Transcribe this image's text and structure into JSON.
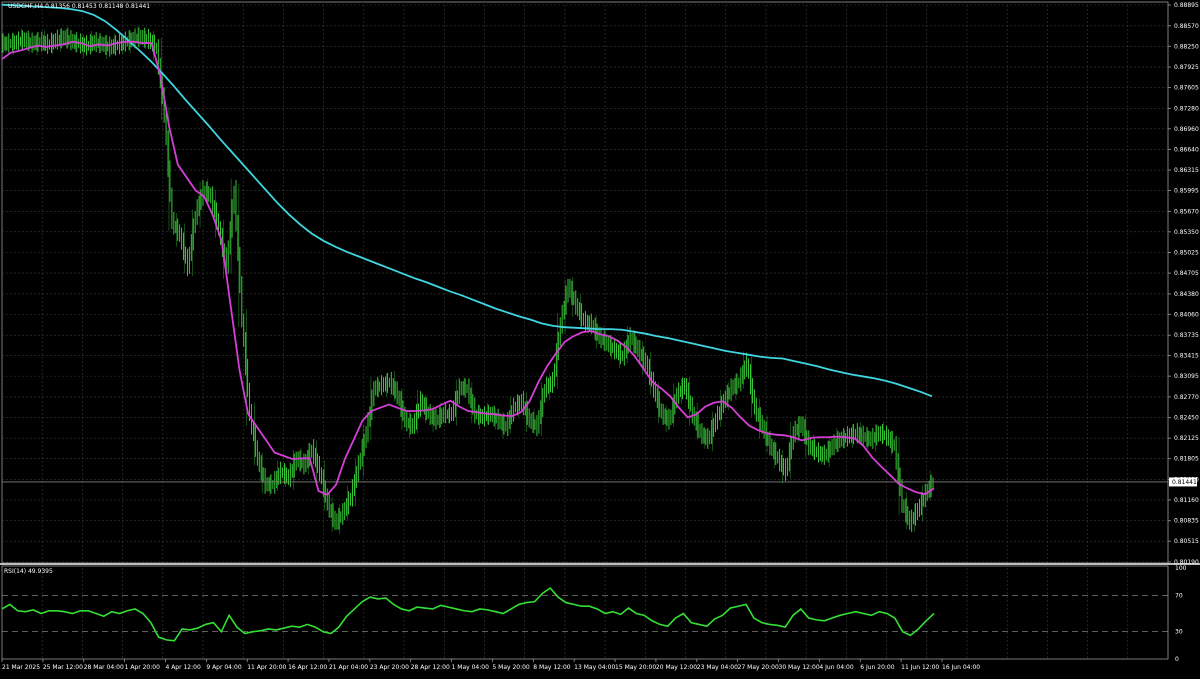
{
  "header": {
    "symbol_line": "USDCHF,H4  0.81356 0.81453 0.81148 0.81441",
    "rsi_label": "RSI(14) 49.9395"
  },
  "colors": {
    "background": "#000000",
    "grid": "#3a3a3a",
    "candle": "#3fdc3f",
    "ma_fast": "#d63fd6",
    "ma_slow": "#3fd6e0",
    "rsi": "#35e035",
    "axis_text": "#ffffff"
  },
  "chart_data": [
    {
      "type": "line",
      "name": "price",
      "x_labels": [
        "21 Mar 2025",
        "25 Mar 12:00",
        "28 Mar 04:00",
        "1 Apr 20:00",
        "4 Apr 12:00",
        "9 Apr 04:00",
        "11 Apr 20:00",
        "16 Apr 12:00",
        "21 Apr 04:00",
        "23 Apr 20:00",
        "28 Apr 12:00",
        "1 May 04:00",
        "5 May 20:00",
        "8 May 12:00",
        "13 May 04:00",
        "15 May 20:00",
        "20 May 12:00",
        "23 May 04:00",
        "27 May 20:00",
        "30 May 12:00",
        "4 Jun 04:00",
        "6 Jun 20:00",
        "11 Jun 12:00",
        "16 Jun 04:00"
      ],
      "y_ticks": [
        0.88895,
        0.8857,
        0.8825,
        0.87925,
        0.87605,
        0.8728,
        0.8696,
        0.8664,
        0.86315,
        0.85995,
        0.8567,
        0.8535,
        0.85025,
        0.84705,
        0.8438,
        0.8406,
        0.83735,
        0.83415,
        0.83095,
        0.8277,
        0.8245,
        0.82125,
        0.81805,
        0.8148,
        0.8116,
        0.80835,
        0.80515,
        0.8019
      ],
      "ylim": [
        0.8019,
        0.88895
      ],
      "current_price": 0.81441,
      "price_close": [
        0.8829,
        0.8831,
        0.8835,
        0.8829,
        0.8832,
        0.8827,
        0.8834,
        0.8838,
        0.8833,
        0.8829,
        0.8825,
        0.8831,
        0.8828,
        0.8823,
        0.8827,
        0.8832,
        0.8836,
        0.8839,
        0.8835,
        0.882,
        0.872,
        0.855,
        0.853,
        0.848,
        0.856,
        0.86,
        0.859,
        0.854,
        0.848,
        0.86,
        0.84,
        0.825,
        0.818,
        0.814,
        0.814,
        0.816,
        0.815,
        0.818,
        0.817,
        0.8195,
        0.816,
        0.811,
        0.808,
        0.8095,
        0.812,
        0.817,
        0.822,
        0.829,
        0.8295,
        0.83,
        0.828,
        0.824,
        0.823,
        0.827,
        0.825,
        0.824,
        0.825,
        0.825,
        0.829,
        0.829,
        0.825,
        0.8245,
        0.825,
        0.824,
        0.823,
        0.826,
        0.827,
        0.824,
        0.823,
        0.829,
        0.83,
        0.839,
        0.845,
        0.842,
        0.8395,
        0.839,
        0.837,
        0.836,
        0.835,
        0.834,
        0.837,
        0.835,
        0.833,
        0.829,
        0.825,
        0.824,
        0.828,
        0.8295,
        0.825,
        0.822,
        0.821,
        0.824,
        0.827,
        0.829,
        0.83,
        0.833,
        0.826,
        0.823,
        0.82,
        0.818,
        0.816,
        0.822,
        0.8235,
        0.82,
        0.819,
        0.8185,
        0.82,
        0.821,
        0.8215,
        0.822,
        0.8215,
        0.821,
        0.822,
        0.8215,
        0.82,
        0.811,
        0.808,
        0.81,
        0.8125,
        0.8144
      ],
      "ma_slow": [
        0.889,
        0.8889,
        0.8888,
        0.8887,
        0.8886,
        0.8885,
        0.8883,
        0.888,
        0.8874,
        0.8864,
        0.885,
        0.8834,
        0.8818,
        0.8801,
        0.8782,
        0.8762,
        0.8741,
        0.8721,
        0.8701,
        0.868,
        0.866,
        0.864,
        0.862,
        0.86,
        0.858,
        0.8562,
        0.8546,
        0.8532,
        0.8521,
        0.8512,
        0.8504,
        0.8497,
        0.849,
        0.8483,
        0.8476,
        0.8469,
        0.8462,
        0.8456,
        0.8449,
        0.8442,
        0.8436,
        0.8429,
        0.8422,
        0.8415,
        0.8409,
        0.8403,
        0.8398,
        0.8392,
        0.8388,
        0.8386,
        0.8385,
        0.8384,
        0.8383,
        0.8383,
        0.8382,
        0.8379,
        0.8376,
        0.8372,
        0.8369,
        0.8365,
        0.8361,
        0.8357,
        0.8353,
        0.8349,
        0.8346,
        0.8343,
        0.834,
        0.8338,
        0.8337,
        0.8333,
        0.8329,
        0.8325,
        0.832,
        0.8316,
        0.8312,
        0.8309,
        0.8306,
        0.8302,
        0.8297,
        0.8291,
        0.8285,
        0.8278
      ],
      "ma_fast": [
        0.8805,
        0.8815,
        0.8818,
        0.8822,
        0.8826,
        0.8824,
        0.8826,
        0.8828,
        0.8832,
        0.883,
        0.8825,
        0.8828,
        0.8826,
        0.883,
        0.8832,
        0.8832,
        0.883,
        0.883,
        0.878,
        0.87,
        0.864,
        0.862,
        0.86,
        0.859,
        0.856,
        0.852,
        0.842,
        0.832,
        0.825,
        0.823,
        0.821,
        0.819,
        0.8185,
        0.818,
        0.8181,
        0.8181,
        0.813,
        0.8124,
        0.814,
        0.818,
        0.821,
        0.824,
        0.8255,
        0.826,
        0.8265,
        0.826,
        0.8255,
        0.8255,
        0.8256,
        0.8258,
        0.8265,
        0.8271,
        0.8262,
        0.8255,
        0.8253,
        0.8251,
        0.825,
        0.8248,
        0.8247,
        0.8253,
        0.827,
        0.83,
        0.8325,
        0.8345,
        0.8363,
        0.8372,
        0.8378,
        0.838,
        0.8375,
        0.8372,
        0.8365,
        0.8355,
        0.834,
        0.832,
        0.83,
        0.829,
        0.8278,
        0.826,
        0.8245,
        0.825,
        0.8262,
        0.8268,
        0.827,
        0.826,
        0.8245,
        0.8232,
        0.8225,
        0.822,
        0.8218,
        0.8217,
        0.8214,
        0.8209,
        0.8213,
        0.8214,
        0.8214,
        0.8215,
        0.8214,
        0.8212,
        0.82,
        0.8182,
        0.8168,
        0.8155,
        0.8141,
        0.8134,
        0.8128,
        0.8125,
        0.8134
      ]
    },
    {
      "type": "line",
      "name": "RSI(14)",
      "ylim": [
        0,
        100
      ],
      "y_ticks": [
        100,
        70,
        30,
        0
      ],
      "levels": [
        70,
        30
      ],
      "values": [
        55,
        60,
        53,
        52,
        54,
        50,
        53,
        53,
        52,
        50,
        53,
        53,
        50,
        47,
        52,
        50,
        53,
        55,
        50,
        40,
        24,
        21,
        20,
        33,
        32,
        34,
        38,
        40,
        30,
        48,
        35,
        28,
        30,
        31,
        33,
        32,
        34,
        36,
        35,
        38,
        35,
        30,
        28,
        35,
        47,
        55,
        63,
        68,
        66,
        67,
        60,
        55,
        53,
        57,
        56,
        55,
        59,
        57,
        55,
        53,
        52,
        55,
        54,
        52,
        50,
        55,
        60,
        62,
        63,
        72,
        78,
        68,
        62,
        60,
        58,
        58,
        55,
        50,
        52,
        49,
        56,
        50,
        48,
        42,
        38,
        36,
        45,
        50,
        40,
        38,
        36,
        44,
        48,
        56,
        58,
        60,
        45,
        40,
        38,
        37,
        35,
        48,
        55,
        45,
        43,
        42,
        45,
        48,
        50,
        52,
        50,
        48,
        52,
        50,
        45,
        30,
        26,
        33,
        42,
        50
      ]
    }
  ]
}
